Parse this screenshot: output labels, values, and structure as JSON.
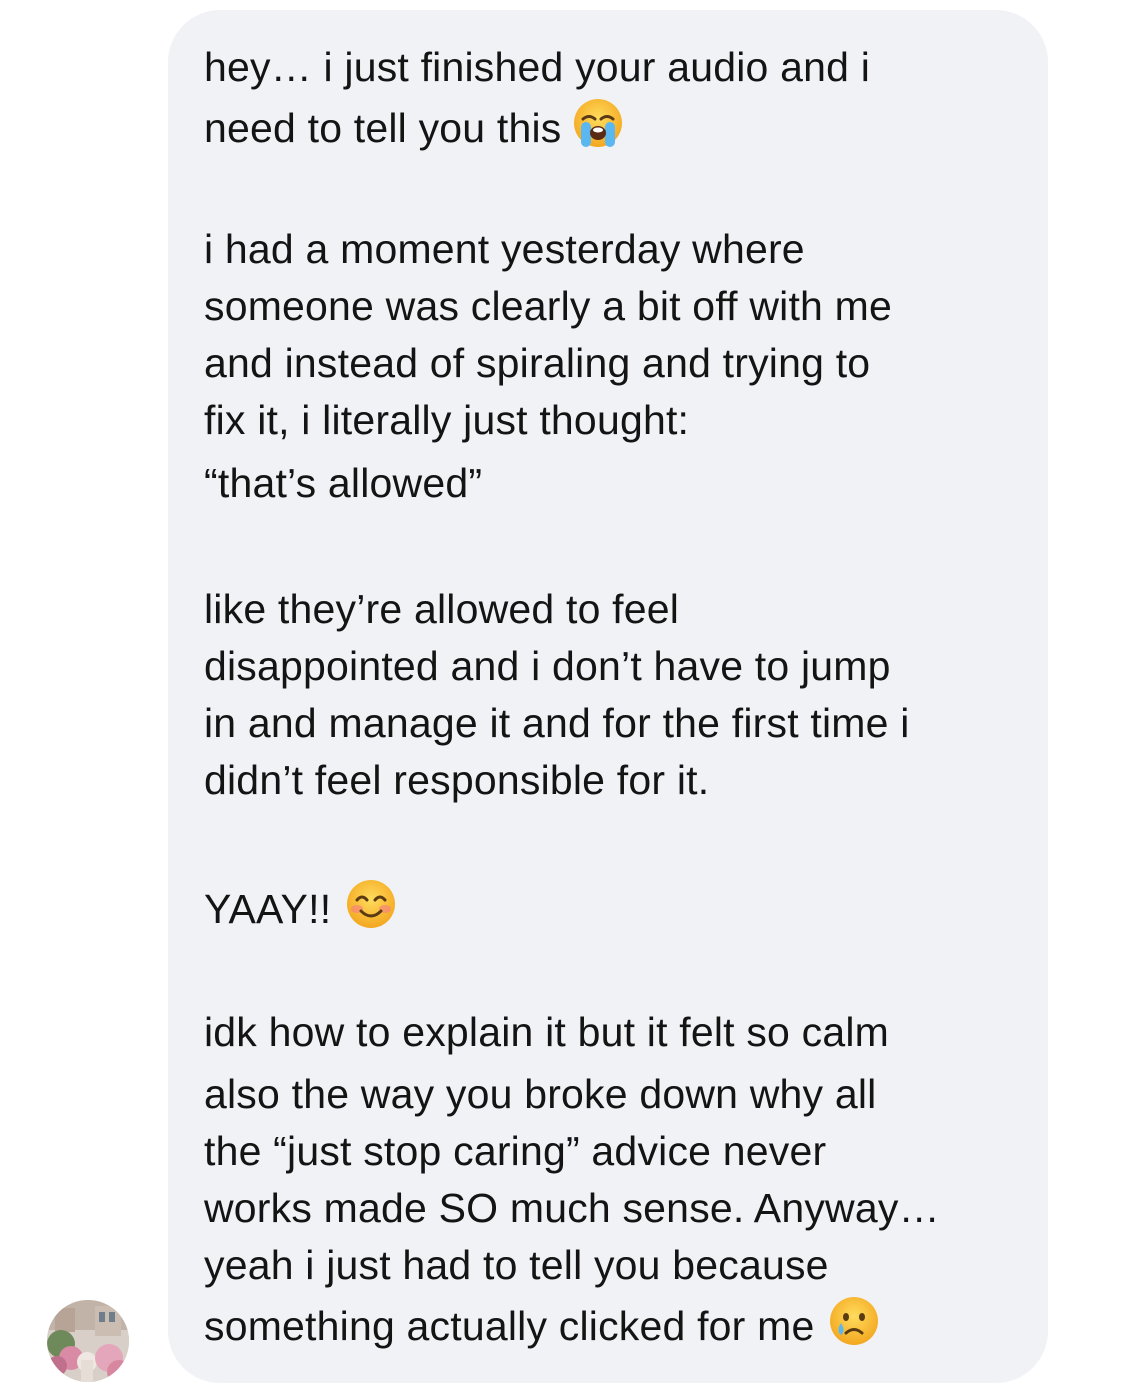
{
  "conversation": {
    "message": {
      "lines": [
        "hey… i just finished your audio and i",
        "need to tell you this",
        "i had a moment yesterday where",
        "someone was clearly a bit off with me",
        "and instead of spiraling and trying to",
        "fix it, i literally just thought:",
        "“that’s allowed”",
        "like they’re allowed to feel",
        "disappointed and i don’t have to jump",
        "in and manage it and for the first time i",
        "didn’t feel responsible for it.",
        "YAAY!!",
        "idk how to explain it but it felt so calm",
        "also the way you broke down why all",
        "the “just stop caring” advice never",
        "works made SO much sense. Anyway…",
        "yeah i just had to tell you because",
        "something actually clicked for me"
      ],
      "emojis": {
        "line_2": "loudly-crying-face-icon",
        "line_12": "smiling-face-icon",
        "line_18": "crying-face-icon"
      }
    },
    "sender_avatar": "avatar",
    "colors": {
      "bubble": "#f1f2f6",
      "text": "#141414",
      "emoji_yellow": "#f7c23f"
    }
  }
}
